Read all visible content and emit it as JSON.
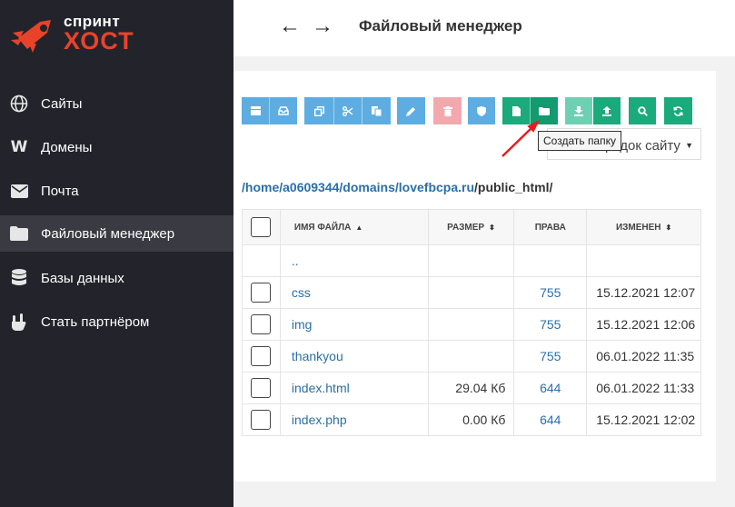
{
  "brand": {
    "line1": "спринт",
    "line2": "ХОСТ"
  },
  "sidebar": {
    "items": [
      {
        "label": "Сайты",
        "icon": "globe-icon"
      },
      {
        "label": "Домены",
        "icon": "w-icon"
      },
      {
        "label": "Почта",
        "icon": "mail-icon"
      },
      {
        "label": "Файловый менеджер",
        "icon": "folder-icon",
        "active": true
      },
      {
        "label": "Базы данных",
        "icon": "database-icon"
      },
      {
        "label": "Стать партнёром",
        "icon": "hand-icon"
      }
    ]
  },
  "header": {
    "back": "←",
    "forward": "→",
    "title": "Файловый менеджер"
  },
  "toolbar": {
    "tooltip": "Создать папку",
    "select_value": "…рядок сайту",
    "colors": {
      "blue": "#5dade2",
      "pink": "#f1a9ae",
      "green": "#1aaa7c",
      "light_green": "#6ed0b2"
    }
  },
  "path": {
    "parts": [
      "/home/a0609344",
      "/domains",
      "/lovefbcpa.ru",
      "/public_html/"
    ]
  },
  "table": {
    "columns": {
      "name": "ИМЯ ФАЙЛА",
      "size": "РАЗМЕР",
      "perms": "ПРАВА",
      "modified": "ИЗМЕНЕН"
    },
    "rows": [
      {
        "name": "..",
        "size": "",
        "perms": "",
        "modified": ""
      },
      {
        "name": "css",
        "size": "",
        "perms": "755",
        "modified": "15.12.2021 12:07"
      },
      {
        "name": "img",
        "size": "",
        "perms": "755",
        "modified": "15.12.2021 12:06"
      },
      {
        "name": "thankyou",
        "size": "",
        "perms": "755",
        "modified": "06.01.2022 11:35"
      },
      {
        "name": "index.html",
        "size": "29.04 Кб",
        "perms": "644",
        "modified": "06.01.2022 11:33"
      },
      {
        "name": "index.php",
        "size": "0.00 Кб",
        "perms": "644",
        "modified": "15.12.2021 12:02"
      }
    ]
  }
}
